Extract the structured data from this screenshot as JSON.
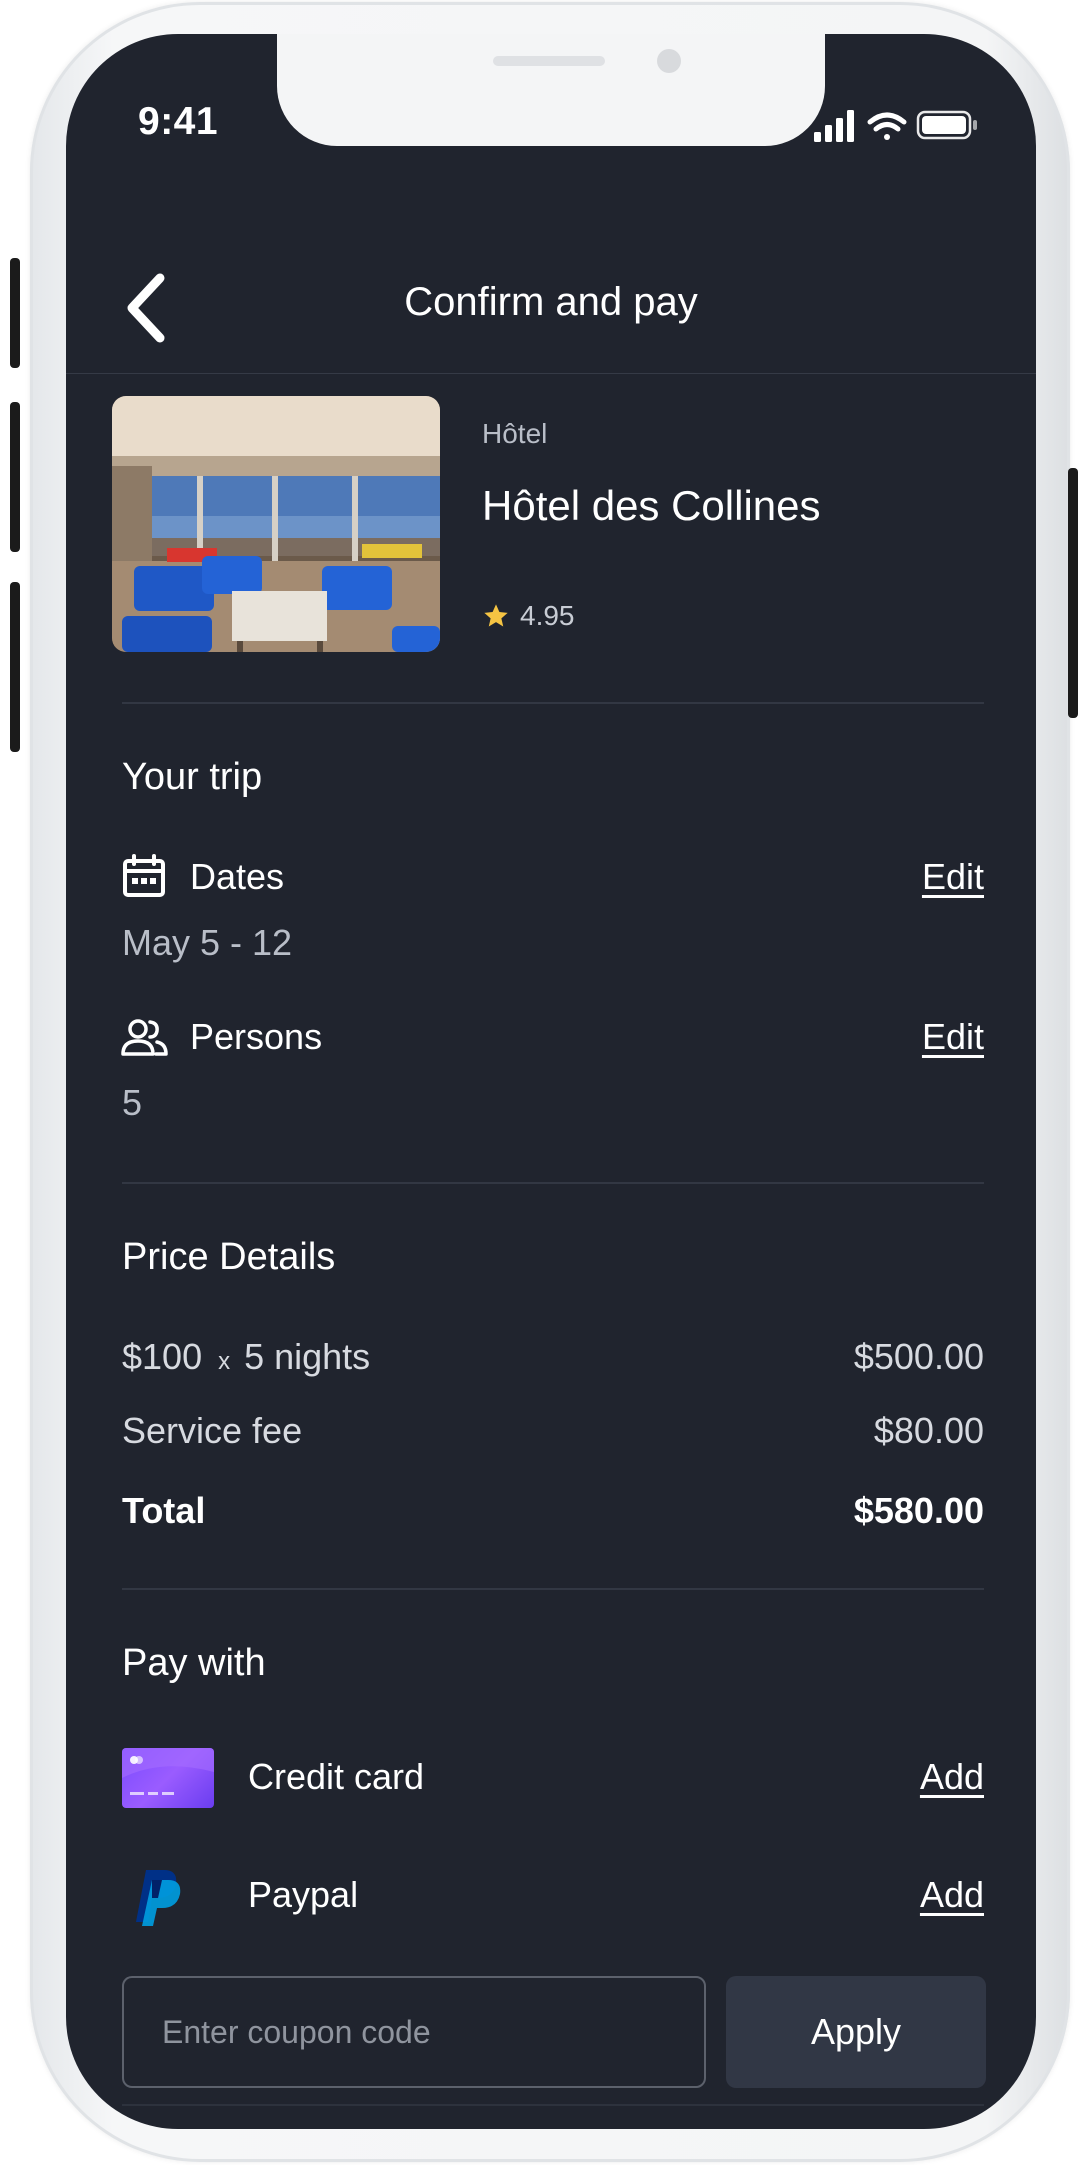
{
  "status_bar": {
    "time": "9:41"
  },
  "header": {
    "title": "Confirm and pay"
  },
  "listing": {
    "type": "Hôtel",
    "name": "Hôtel des Collines",
    "rating": "4.95"
  },
  "trip": {
    "title": "Your trip",
    "dates": {
      "label": "Dates",
      "value": "May 5 - 12",
      "edit": "Edit"
    },
    "persons": {
      "label": "Persons",
      "value": "5",
      "edit": "Edit"
    }
  },
  "price": {
    "title": "Price Details",
    "nightly_rate": "$100",
    "times": "x",
    "nights": "5 nights",
    "subtotal": "$500.00",
    "service_fee_label": "Service fee",
    "service_fee": "$80.00",
    "total_label": "Total",
    "total": "$580.00"
  },
  "pay_with": {
    "title": "Pay with",
    "methods": [
      {
        "label": "Credit card",
        "action": "Add",
        "icon": "credit-card-icon"
      },
      {
        "label": "Paypal",
        "action": "Add",
        "icon": "paypal-icon"
      }
    ]
  },
  "coupon": {
    "placeholder": "Enter coupon code",
    "apply": "Apply"
  },
  "colors": {
    "background": "#20242e",
    "divider": "#323743",
    "star": "#f5c443",
    "button": "#313745",
    "card": "#8a55ff",
    "paypal_dark": "#003087",
    "paypal_light": "#009cde"
  }
}
